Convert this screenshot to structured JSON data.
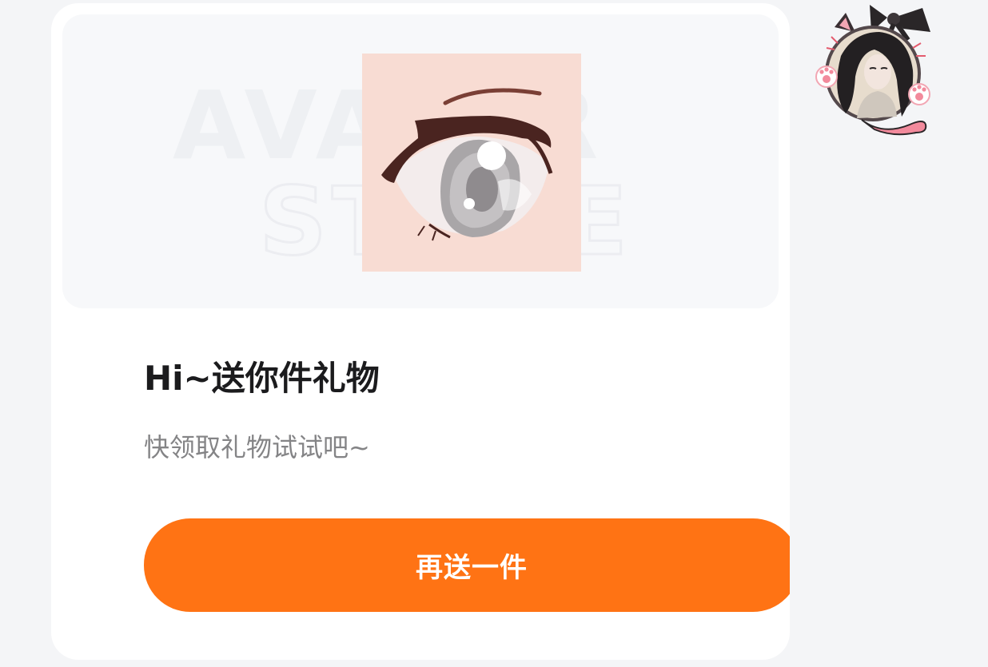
{
  "gift_card": {
    "banner_watermark_line1": "AVATAR",
    "banner_watermark_line2": "STORE",
    "title": "Hi~送你件礼物",
    "subtitle": "快领取礼物试试吧~",
    "action_button_label": "再送一件"
  },
  "colors": {
    "page_background": "#f4f5f7",
    "card_background": "#ffffff",
    "accent": "#ff7314",
    "title_text": "#1b1b1d",
    "subtitle_text": "#848486"
  },
  "icons": {
    "gift_image": "anime-eye-avatar-frame",
    "sender_avatar": "cat-ear-avatar-frame"
  }
}
